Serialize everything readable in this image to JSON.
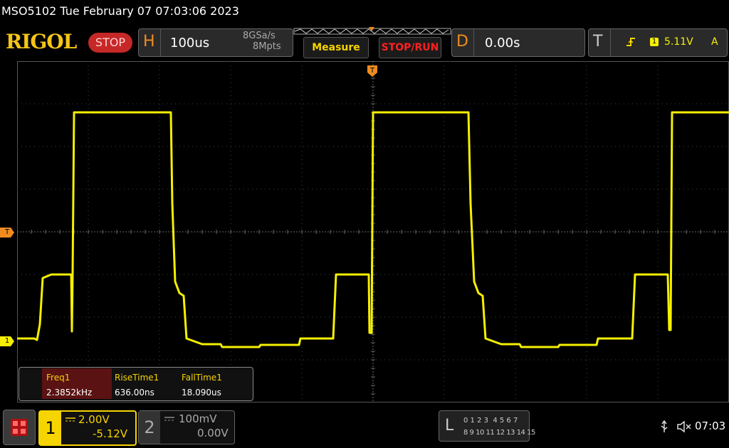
{
  "title_bar": {
    "text": "MSO5102  Tue February 07 07:03:06 2023"
  },
  "logo": "RIGOL",
  "run_state": "STOP",
  "horizontal": {
    "letter": "H",
    "timebase": "100us",
    "sample_rate": "8GSa/s",
    "memory_depth": "8Mpts"
  },
  "buttons": {
    "measure": "Measure",
    "stop_run": "STOP/RUN"
  },
  "delay": {
    "letter": "D",
    "value": "0.00s"
  },
  "trigger": {
    "letter": "T",
    "source_channel": "1",
    "level": "5.11V",
    "mode": "A"
  },
  "markers": {
    "trigger_level": "T",
    "ch1": "1"
  },
  "measurements": [
    {
      "label": "Freq1",
      "value": "2.3852kHz"
    },
    {
      "label": "RiseTime1",
      "value": "636.00ns"
    },
    {
      "label": "FallTime1",
      "value": "18.090us"
    }
  ],
  "ch1": {
    "number": "1",
    "scale": "2.00V",
    "offset": "-5.12V"
  },
  "ch2": {
    "number": "2",
    "scale": "100mV",
    "offset": "0.00V"
  },
  "logic": {
    "letter": "L",
    "row1": "0 1 2 3  4 5 6 7",
    "row2": "8 9 10 11 12 13 14 15"
  },
  "status": {
    "time": "07:03"
  },
  "colors": {
    "ch1": "#f5f000",
    "orange": "#f08c1f",
    "stop": "#c62828"
  },
  "icons": [
    "menu-icon",
    "usb-icon",
    "speaker-mute-icon",
    "rising-edge-icon"
  ]
}
